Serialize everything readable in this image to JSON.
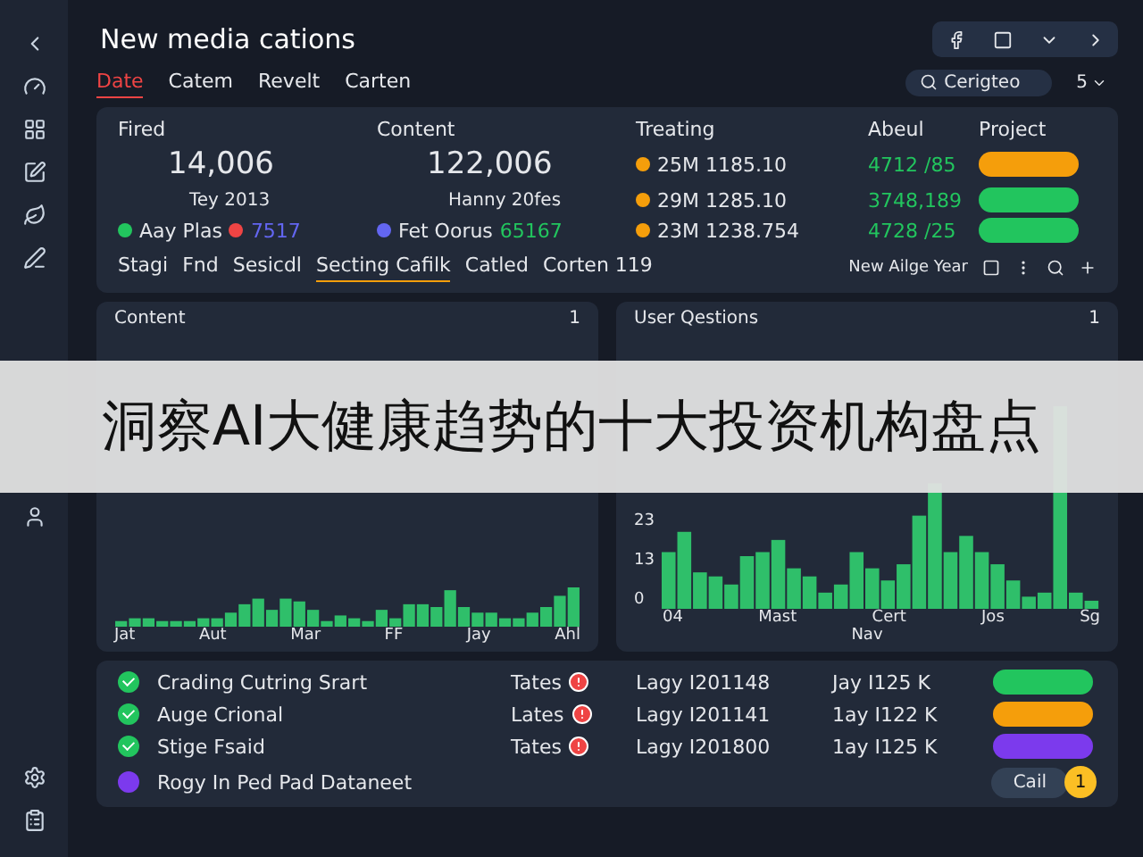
{
  "header": {
    "title": "New media cations",
    "search": {
      "placeholder": "Cerigteo"
    },
    "menu_label": "5"
  },
  "tabs": [
    {
      "label": "Date",
      "selected": true
    },
    {
      "label": "Catem",
      "selected": false
    },
    {
      "label": "Revelt",
      "selected": false
    },
    {
      "label": "Carten",
      "selected": false
    }
  ],
  "stats": {
    "columns": [
      "Fired",
      "Content",
      "Treating",
      "Abeul",
      "Project"
    ],
    "metrics": [
      {
        "value": "14,006",
        "caption": "Tey 2013"
      },
      {
        "value": "122,006",
        "caption": "Hanny 20fes"
      }
    ],
    "legend": [
      {
        "label": "Aay Plas",
        "color": "#22c55e"
      },
      {
        "label": "7517",
        "color": "#ef4444"
      },
      {
        "label": "Fet Oorus",
        "color": "#6366f1"
      }
    ],
    "legend_value": "65167",
    "trending": [
      {
        "code": "25M 1185.10",
        "amount": "4712 /85",
        "color": "#f59e0b"
      },
      {
        "code": "29M 1285.10",
        "amount": "3748,189",
        "color": "#22c55e"
      },
      {
        "code": "23M 1238.754",
        "amount": "4728 /25",
        "color": "#22c55e"
      }
    ]
  },
  "filters": [
    {
      "label": "Stagi",
      "selected": false
    },
    {
      "label": "Fnd",
      "selected": false
    },
    {
      "label": "Sesicdl",
      "selected": false
    },
    {
      "label": "Secting Cafilk",
      "selected": true
    },
    {
      "label": "Catled",
      "selected": false
    },
    {
      "label": "Corten 119",
      "selected": false
    }
  ],
  "filter_right": "New Ailge Year",
  "charts": [
    {
      "title": "Content",
      "count": "1",
      "x_labels": [
        "Jat",
        "Aut",
        "Mar",
        "FF",
        "Jay",
        "Ahl"
      ]
    },
    {
      "title": "User Qestions",
      "count": "1",
      "y_labels": [
        "23",
        "13",
        "0"
      ],
      "x_labels": [
        "04",
        "Mast",
        "Cert",
        "Jos",
        "Sg"
      ],
      "sub_label": "Nav"
    }
  ],
  "list": [
    {
      "kind": "row",
      "title": "Crading Cutring Srart",
      "icon": {
        "color": "#22c55e"
      },
      "tag": "Tates",
      "date": "Lagy I201148",
      "value": "Jay I125 K",
      "status": {
        "color": "#22c55e"
      }
    },
    {
      "kind": "row",
      "title": "Auge Crional",
      "icon": {
        "color": "#22c55e"
      },
      "tag": "Lates",
      "date": "Lagy I201141",
      "value": "1ay I122 K",
      "status": {
        "color": "#f59e0b"
      }
    },
    {
      "kind": "row",
      "title": "Stige Fsaid",
      "icon": {
        "color": "#22c55e"
      },
      "tag": "Tates",
      "date": "Lagy I201800",
      "value": "1ay I125 K",
      "status": {
        "color": "#7c3aed"
      }
    },
    {
      "kind": "action",
      "title": "Rogy In Ped Pad Dataneet",
      "icon": {
        "color": "#7c3aed"
      },
      "button": "Cail",
      "badge": "1"
    }
  ],
  "banner": "洞察AI大健康趋势的十大投资机构盘点"
}
